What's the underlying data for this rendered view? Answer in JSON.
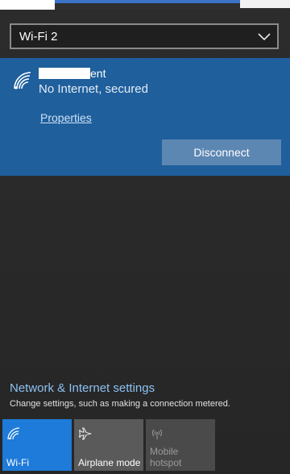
{
  "adapter": {
    "selected": "Wi-Fi 2",
    "icon": "chevron-down-icon"
  },
  "network": {
    "ssid_visible_suffix": "ent",
    "status": "No Internet, secured",
    "properties_label": "Properties",
    "disconnect_label": "Disconnect",
    "icon": "wifi-signal-icon"
  },
  "settings": {
    "title": "Network & Internet settings",
    "description": "Change settings, such as making a connection metered."
  },
  "quick_actions": [
    {
      "label": "Wi-Fi",
      "icon": "wifi-icon",
      "state": "on"
    },
    {
      "label": "Airplane mode",
      "icon": "airplane-icon",
      "state": "off"
    },
    {
      "label": "Mobile hotspot",
      "icon": "hotspot-icon",
      "state": "disabled"
    }
  ],
  "colors": {
    "accent": "#1e7bd9",
    "card": "#1f5f9c",
    "link": "#8cc1f2"
  }
}
